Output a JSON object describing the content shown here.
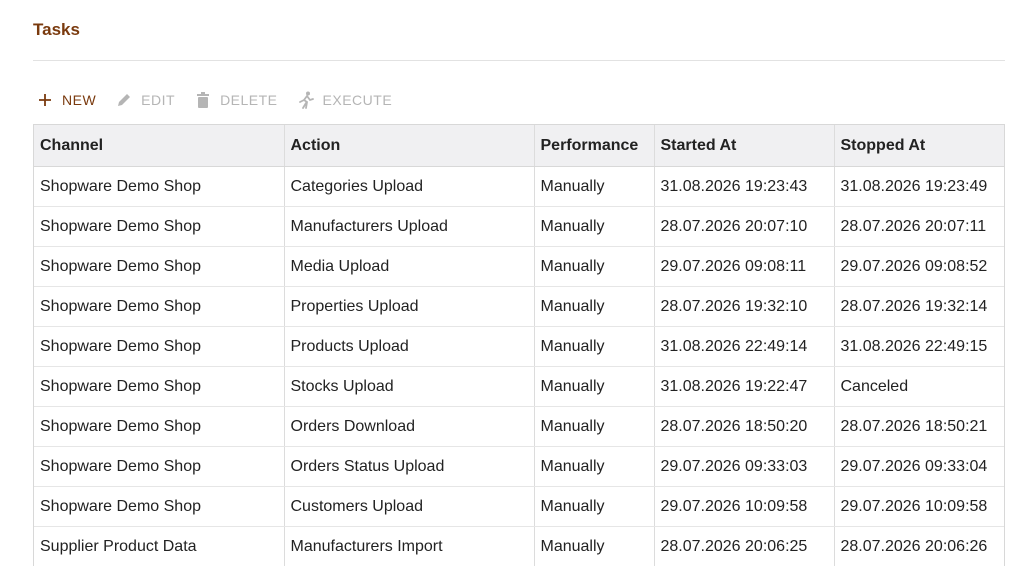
{
  "page": {
    "title": "Tasks"
  },
  "toolbar": {
    "new_label": "NEW",
    "edit_label": "EDIT",
    "delete_label": "DELETE",
    "execute_label": "EXECUTE",
    "icons": {
      "new": "plus-icon",
      "edit": "pencil-icon",
      "delete": "trash-icon",
      "execute": "run-icon"
    },
    "colors": {
      "accent": "#7a3a0e",
      "disabled": "#b5b5b5"
    }
  },
  "table": {
    "columns": [
      "Channel",
      "Action",
      "Performance",
      "Started At",
      "Stopped At"
    ],
    "rows": [
      [
        "Shopware Demo Shop",
        "Categories Upload",
        "Manually",
        "31.08.2026 19:23:43",
        "31.08.2026 19:23:49"
      ],
      [
        "Shopware Demo Shop",
        "Manufacturers Upload",
        "Manually",
        "28.07.2026 20:07:10",
        "28.07.2026 20:07:11"
      ],
      [
        "Shopware Demo Shop",
        "Media Upload",
        "Manually",
        "29.07.2026 09:08:11",
        "29.07.2026 09:08:52"
      ],
      [
        "Shopware Demo Shop",
        "Properties Upload",
        "Manually",
        "28.07.2026 19:32:10",
        "28.07.2026 19:32:14"
      ],
      [
        "Shopware Demo Shop",
        "Products Upload",
        "Manually",
        "31.08.2026 22:49:14",
        "31.08.2026 22:49:15"
      ],
      [
        "Shopware Demo Shop",
        "Stocks Upload",
        "Manually",
        "31.08.2026 19:22:47",
        "Canceled"
      ],
      [
        "Shopware Demo Shop",
        "Orders Download",
        "Manually",
        "28.07.2026 18:50:20",
        "28.07.2026 18:50:21"
      ],
      [
        "Shopware Demo Shop",
        "Orders Status Upload",
        "Manually",
        "29.07.2026 09:33:03",
        "29.07.2026 09:33:04"
      ],
      [
        "Shopware Demo Shop",
        "Customers Upload",
        "Manually",
        "29.07.2026 10:09:58",
        "29.07.2026 10:09:58"
      ],
      [
        "Supplier Product Data",
        "Manufacturers Import",
        "Manually",
        "28.07.2026 20:06:25",
        "28.07.2026 20:06:26"
      ]
    ]
  }
}
